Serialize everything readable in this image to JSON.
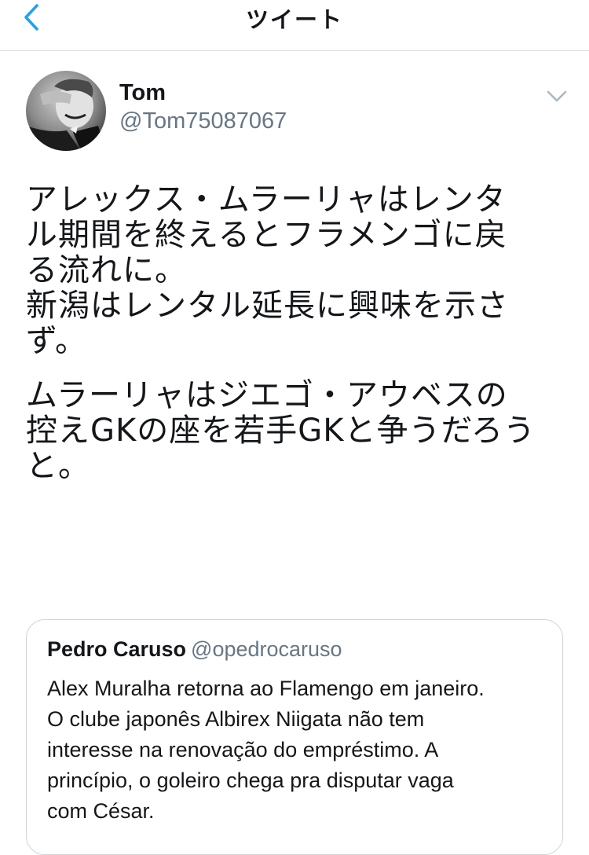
{
  "nav": {
    "title": "ツイート"
  },
  "tweet": {
    "name": "Tom",
    "handle": "@Tom75087067",
    "paragraphs": [
      "アレックス・ムラーリャはレンタ\nル期間を終えるとフラメンゴに戻\nる流れに。\n新潟はレンタル延長に興味を示さ\nず。",
      "ムラーリャはジエゴ・アウベスの\n控えGKの座を若手GKと争うだろう\nと。"
    ]
  },
  "quote": {
    "name": "Pedro Caruso",
    "handle": "@opedrocaruso",
    "text": "Alex Muralha retorna ao Flamengo em janeiro.\nO clube japonês Albirex Niigata não tem\ninteresse na renovação do empréstimo. A\nprincípio, o goleiro chega pra disputar vaga\ncom César."
  },
  "colors": {
    "accent": "#1da1f2",
    "secondary_text": "#657786",
    "border": "#ccd6dd"
  },
  "icons": {
    "back": "chevron-left-icon",
    "more": "chevron-down-icon"
  }
}
